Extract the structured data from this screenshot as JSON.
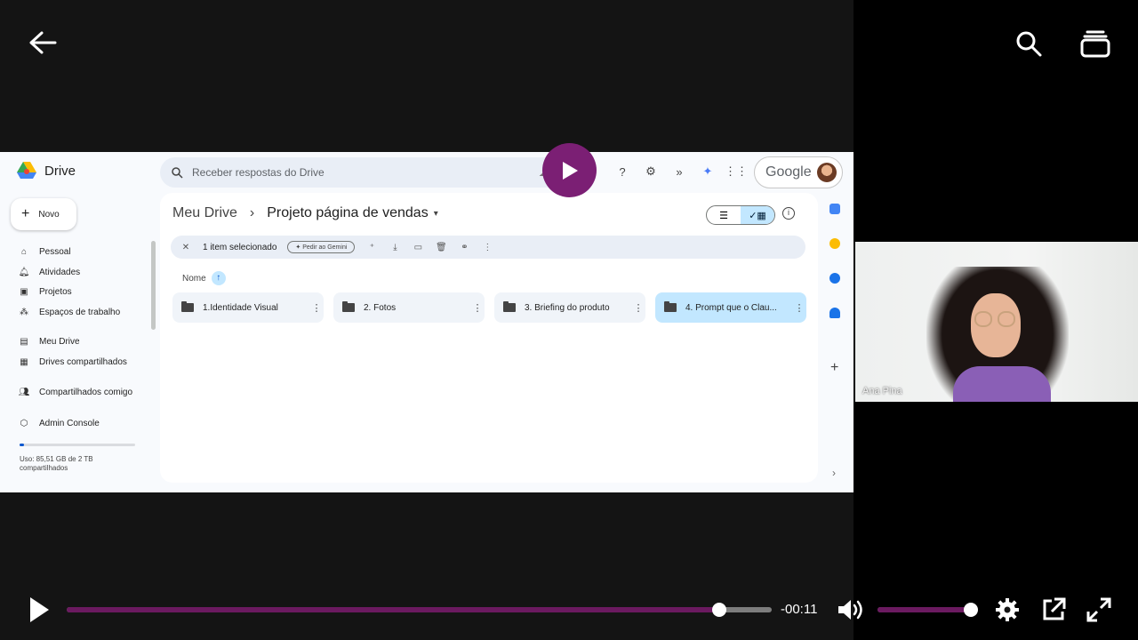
{
  "player": {
    "back_icon": "arrow-left-icon",
    "search_icon": "search-icon",
    "collections_icon": "collections-icon",
    "time_remaining": "-00:11",
    "progress": 0.925,
    "volume": 1.0,
    "accent_color": "#6b1a60",
    "play_color": "#7b1f74"
  },
  "drive": {
    "app_name": "Drive",
    "search_placeholder": "Receber respostas do Drive",
    "google_label": "Google",
    "new_button": "Novo",
    "nav": [
      {
        "label": "Pessoal",
        "icon": "home-icon"
      },
      {
        "label": "Atividades",
        "icon": "bell-icon"
      },
      {
        "label": "Projetos",
        "icon": "project-icon"
      },
      {
        "label": "Espaços de trabalho",
        "icon": "workspaces-icon"
      },
      {
        "label": "Meu Drive",
        "icon": "my-drive-icon"
      },
      {
        "label": "Drives compartilhados",
        "icon": "shared-drives-icon"
      },
      {
        "label": "Compartilhados comigo",
        "icon": "shared-with-me-icon"
      },
      {
        "label": "Admin Console",
        "icon": "admin-icon"
      }
    ],
    "storage_text": "Uso: 85,51 GB de 2 TB compartilhados",
    "breadcrumb_root": "Meu Drive",
    "breadcrumb_current": "Projeto página de vendas",
    "selection_text": "1 item selecionado",
    "gemini_chip": "Pedir ao Gemini",
    "sort_label": "Nome",
    "folders": [
      {
        "name": "1.Identidade Visual",
        "selected": false
      },
      {
        "name": "2. Fotos",
        "selected": false
      },
      {
        "name": "3. Briefing do produto",
        "selected": false
      },
      {
        "name": "4. Prompt que o Clau...",
        "selected": true
      }
    ]
  },
  "webcam": {
    "presenter_name": "Ana Pina"
  }
}
